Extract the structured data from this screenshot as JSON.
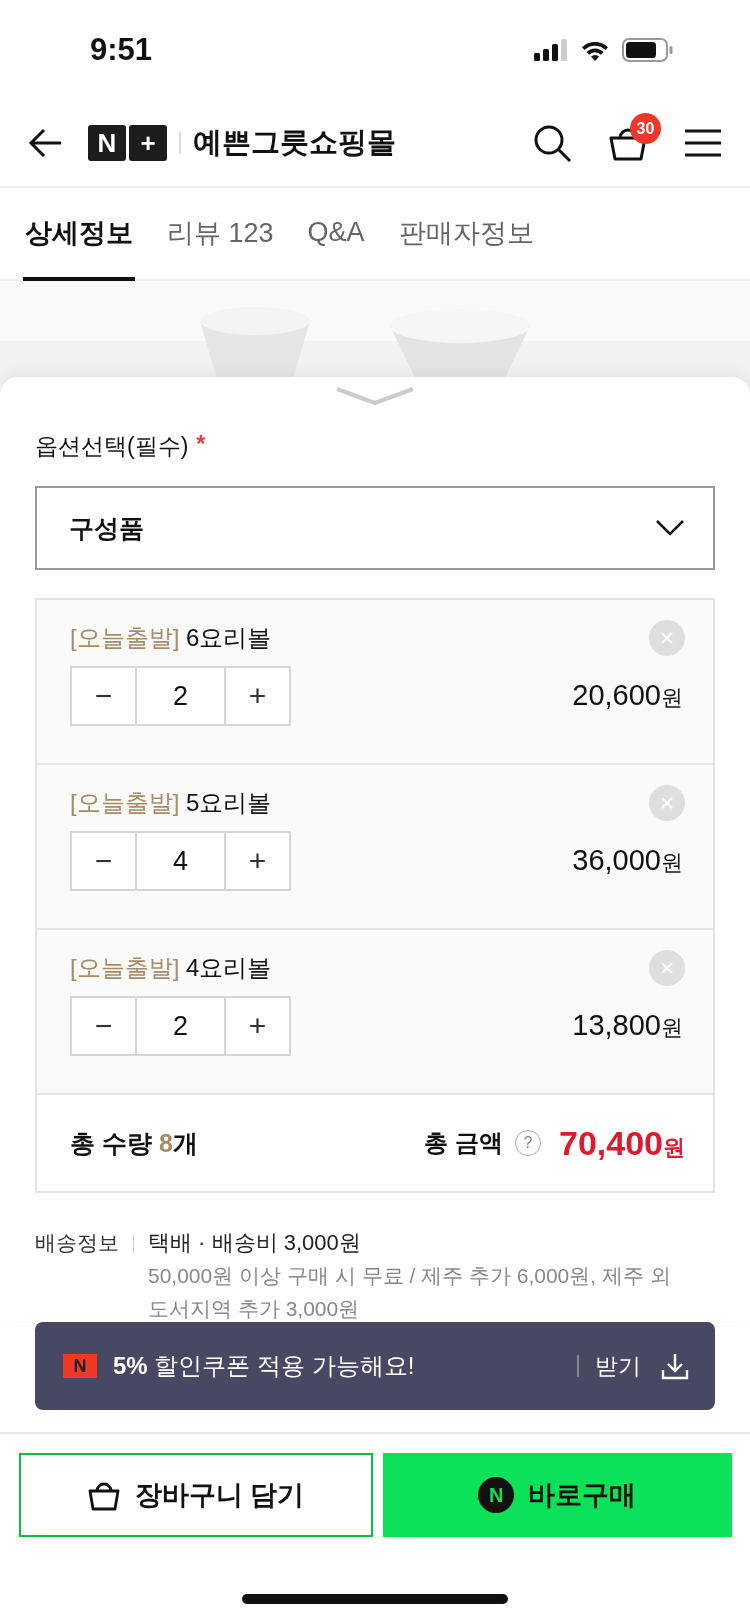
{
  "status_bar": {
    "time": "9:51"
  },
  "header": {
    "logo": [
      "N",
      "+"
    ],
    "store_name": "예쁜그릇쇼핑몰",
    "cart_count": "30"
  },
  "tabs": [
    {
      "label": "상세정보",
      "selected": true
    },
    {
      "label": "리뷰 123",
      "selected": false
    },
    {
      "label": "Q&A",
      "selected": false
    },
    {
      "label": "판매자정보",
      "selected": false
    }
  ],
  "option": {
    "label": "옵션선택(필수)",
    "required_mark": "*",
    "select_value": "구성품"
  },
  "items": [
    {
      "tag": "[오늘출발]",
      "name": "6요리볼",
      "minus": "−",
      "quantity": "2",
      "plus": "+",
      "price": "20,600",
      "currency": "원"
    },
    {
      "tag": "[오늘출발]",
      "name": "5요리볼",
      "minus": "−",
      "quantity": "4",
      "plus": "+",
      "price": "36,000",
      "currency": "원"
    },
    {
      "tag": "[오늘출발]",
      "name": "4요리볼",
      "minus": "−",
      "quantity": "2",
      "plus": "+",
      "price": "13,800",
      "currency": "원"
    }
  ],
  "total": {
    "qty_label": "총 수량",
    "qty_value": "8",
    "qty_unit": "개",
    "amount_label": "총 금액",
    "help": "?",
    "amount": "70,400",
    "currency": "원"
  },
  "shipping": {
    "label": "배송정보",
    "method": "택배 · 배송비 3,000원",
    "note_lines": [
      "50,000원 이상 구매 시 무료 / 제주 추가 6,000원, 제주 외",
      "도서지역 추가 3,000원"
    ]
  },
  "coupon": {
    "badge": "N",
    "percent": "5%",
    "text": "할인쿠폰 적용 가능해요!",
    "action": "받기"
  },
  "buttons": {
    "cart": "장바구니 담기",
    "buy_logo": "N",
    "buy": "바로구매"
  }
}
